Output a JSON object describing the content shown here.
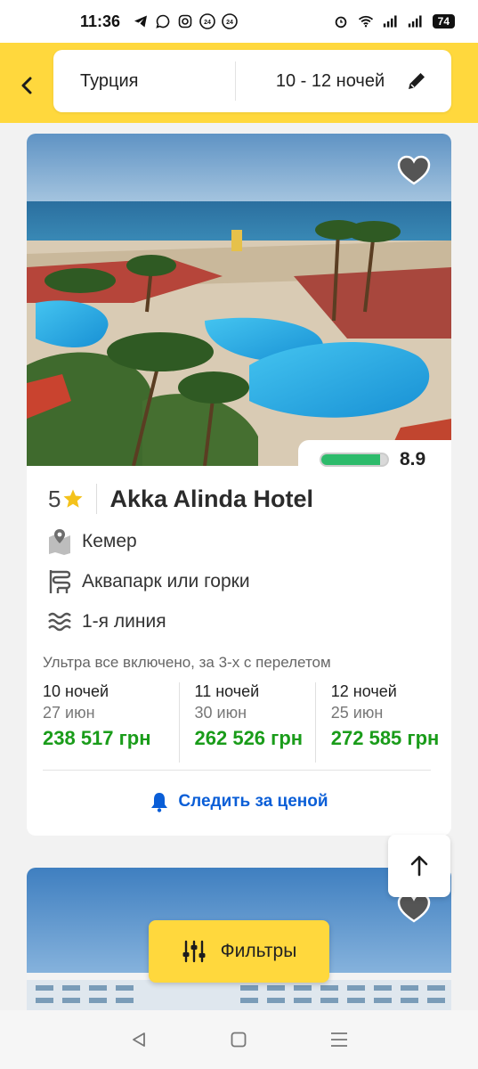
{
  "status_bar": {
    "time": "11:36",
    "battery": "74"
  },
  "header": {
    "country": "Турция",
    "nights": "10 - 12 ночей"
  },
  "hotel": {
    "stars": "5",
    "name": "Akka Alinda Hotel",
    "rating": "8.9",
    "rating_fraction": 0.89,
    "location": "Кемер",
    "feature_waterpark": "Аквапарк или горки",
    "feature_line": "1-я линия",
    "offer_description": "Ультра все включено, за 3-х с перелетом",
    "offers": [
      {
        "nights": "10 ночей",
        "date": "27 июн",
        "price": "238 517 грн"
      },
      {
        "nights": "11 ночей",
        "date": "30 июн",
        "price": "262 526 грн"
      },
      {
        "nights": "12 ночей",
        "date": "25 июн",
        "price": "272 585 грн"
      }
    ],
    "watch_price": "Следить за ценой"
  },
  "filters": {
    "label": "Фильтры"
  },
  "colors": {
    "brand_yellow": "#ffd83d",
    "price_green": "#1a9c1a",
    "link_blue": "#0a5ed7",
    "rating_green": "#2dbb6b"
  },
  "icons": [
    "telegram-icon",
    "viber-icon",
    "instagram-icon",
    "alarm-icon",
    "wifi-icon",
    "signal-icon",
    "battery-icon",
    "back-arrow-icon",
    "pencil-icon",
    "heart-icon",
    "star-icon",
    "map-icon",
    "slide-icon",
    "waves-icon",
    "bell-icon",
    "arrow-up-icon",
    "sliders-icon",
    "nav-back-icon",
    "nav-home-icon",
    "nav-recents-icon"
  ]
}
